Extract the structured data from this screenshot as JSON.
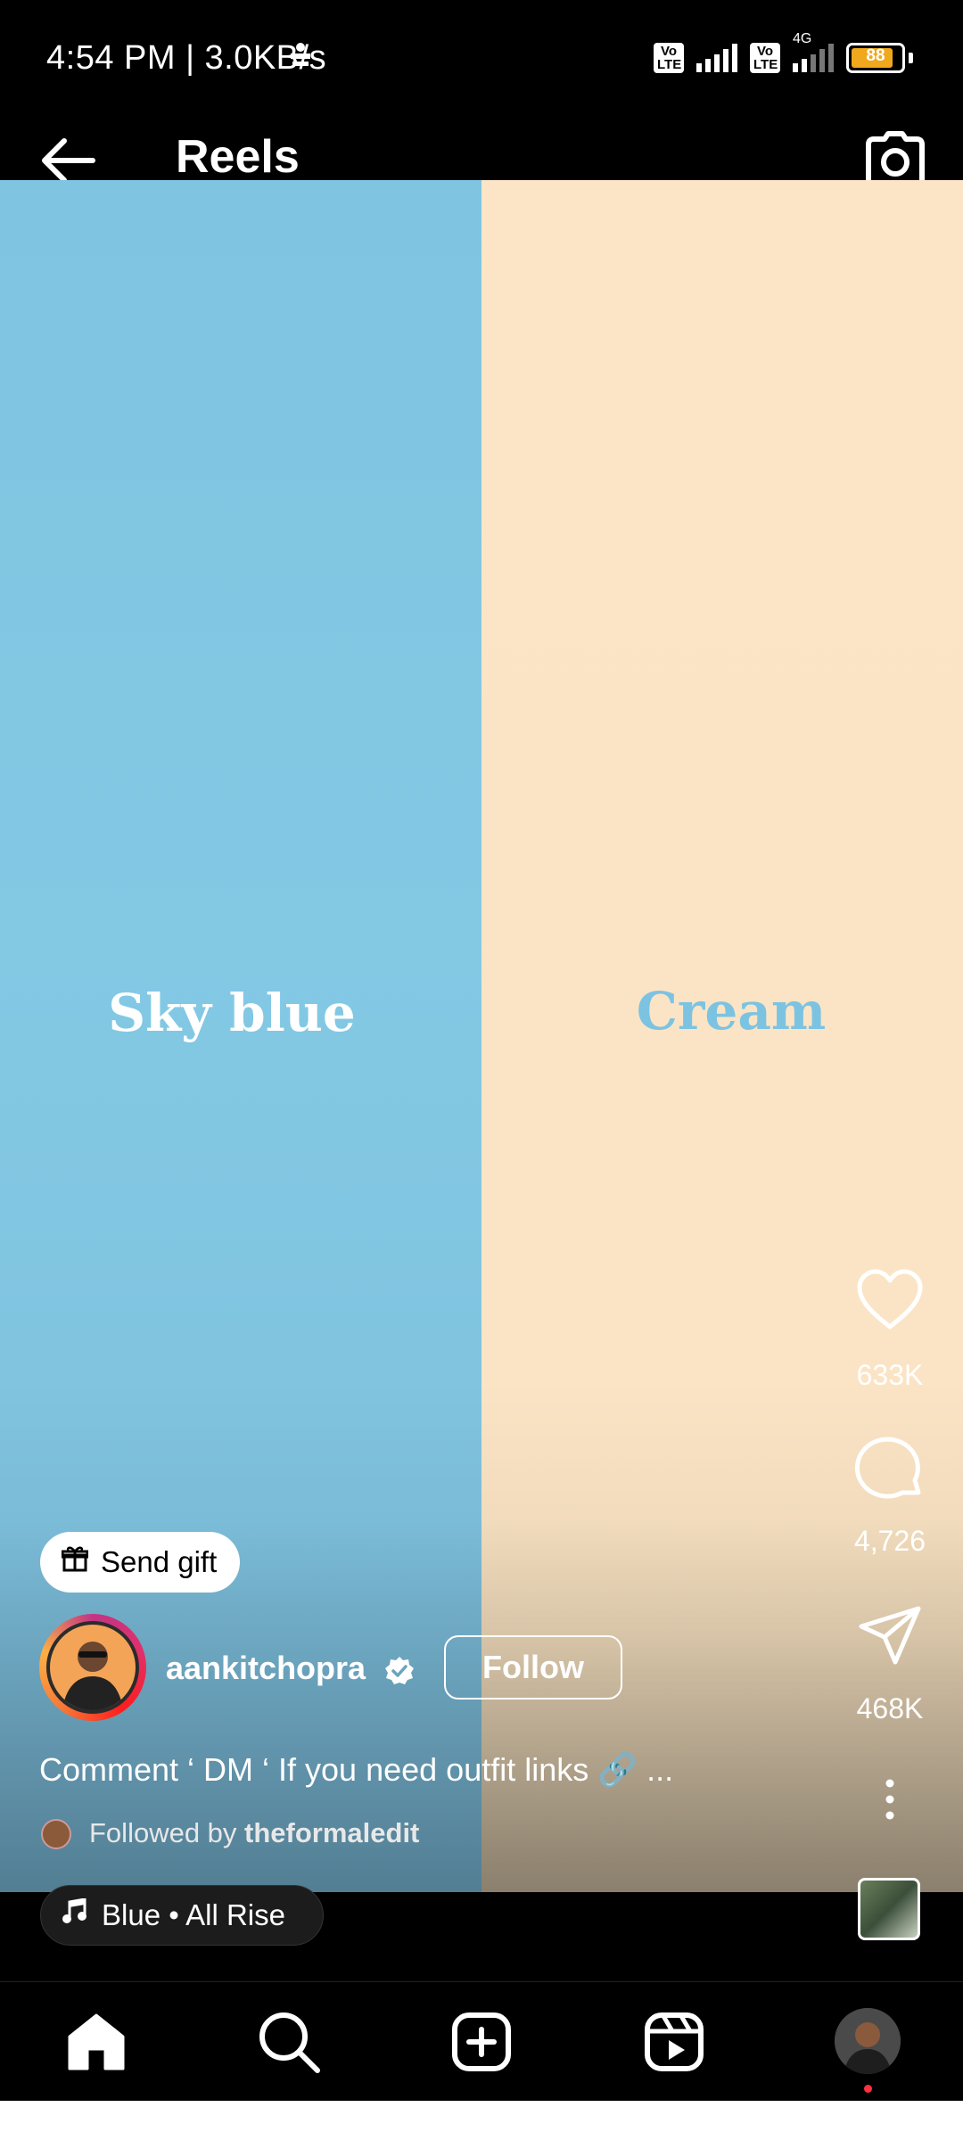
{
  "status_bar": {
    "time_speed": "4:54 PM | 3.0KB/s",
    "volte1": "Vo LTE",
    "volte2": "Vo LTE",
    "network": "4G",
    "battery": "88"
  },
  "header": {
    "title": "Reels"
  },
  "video": {
    "left_label": "Sky blue",
    "right_label": "Cream"
  },
  "actions": {
    "likes": "633K",
    "comments": "4,726",
    "shares": "468K"
  },
  "reel": {
    "send_gift": "Send gift",
    "username": "aankitchopra",
    "follow": "Follow",
    "caption": "Comment ‘ DM ‘ If you need outfit links 🔗 ...",
    "followed_by_prefix": "Followed by ",
    "followed_by_user": "theformaledit",
    "music": "Blue • All Rise"
  },
  "colors": {
    "sky_blue": "#83c9e4",
    "cream": "#fbe5c6",
    "notification_dot": "#ff3040",
    "battery": "#f0a81c"
  },
  "nav_icons": [
    "home-icon",
    "search-icon",
    "create-icon",
    "reels-icon",
    "profile-avatar"
  ]
}
